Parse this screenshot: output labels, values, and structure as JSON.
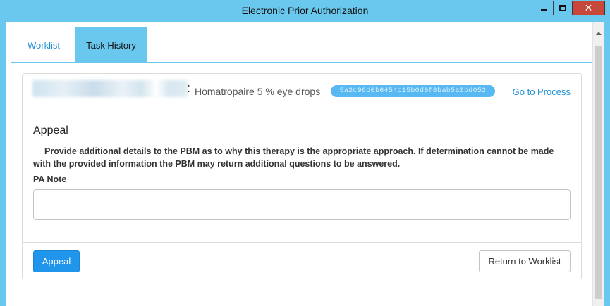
{
  "window": {
    "title": "Electronic Prior Authorization",
    "controls": [
      "minimize-icon",
      "maximize-icon",
      "close-icon"
    ],
    "close_glyph": "✕"
  },
  "tabs": [
    {
      "label": "Worklist",
      "active": false
    },
    {
      "label": "Task History",
      "active": true
    }
  ],
  "request": {
    "colon": ":",
    "drug": "Homatropaire 5 % eye drops",
    "id_badge": "5a2c96d0b6454c15b0d0f0bab5a0bd052",
    "go_to_process": "Go to Process"
  },
  "appeal": {
    "heading": "Appeal",
    "description": "Provide additional details to the PBM as to why this therapy is the appropriate approach. If determination cannot be made with the provided information the PBM may return additional questions to be answered.",
    "note_label": "PA Note",
    "note_value": "",
    "note_placeholder": ""
  },
  "footer": {
    "appeal_button": "Appeal",
    "return_button": "Return to Worklist"
  },
  "colors": {
    "accent": "#6ac8ee",
    "primary_button": "#1f95ec",
    "link": "#1e90d6",
    "close_button": "#c7483b"
  }
}
